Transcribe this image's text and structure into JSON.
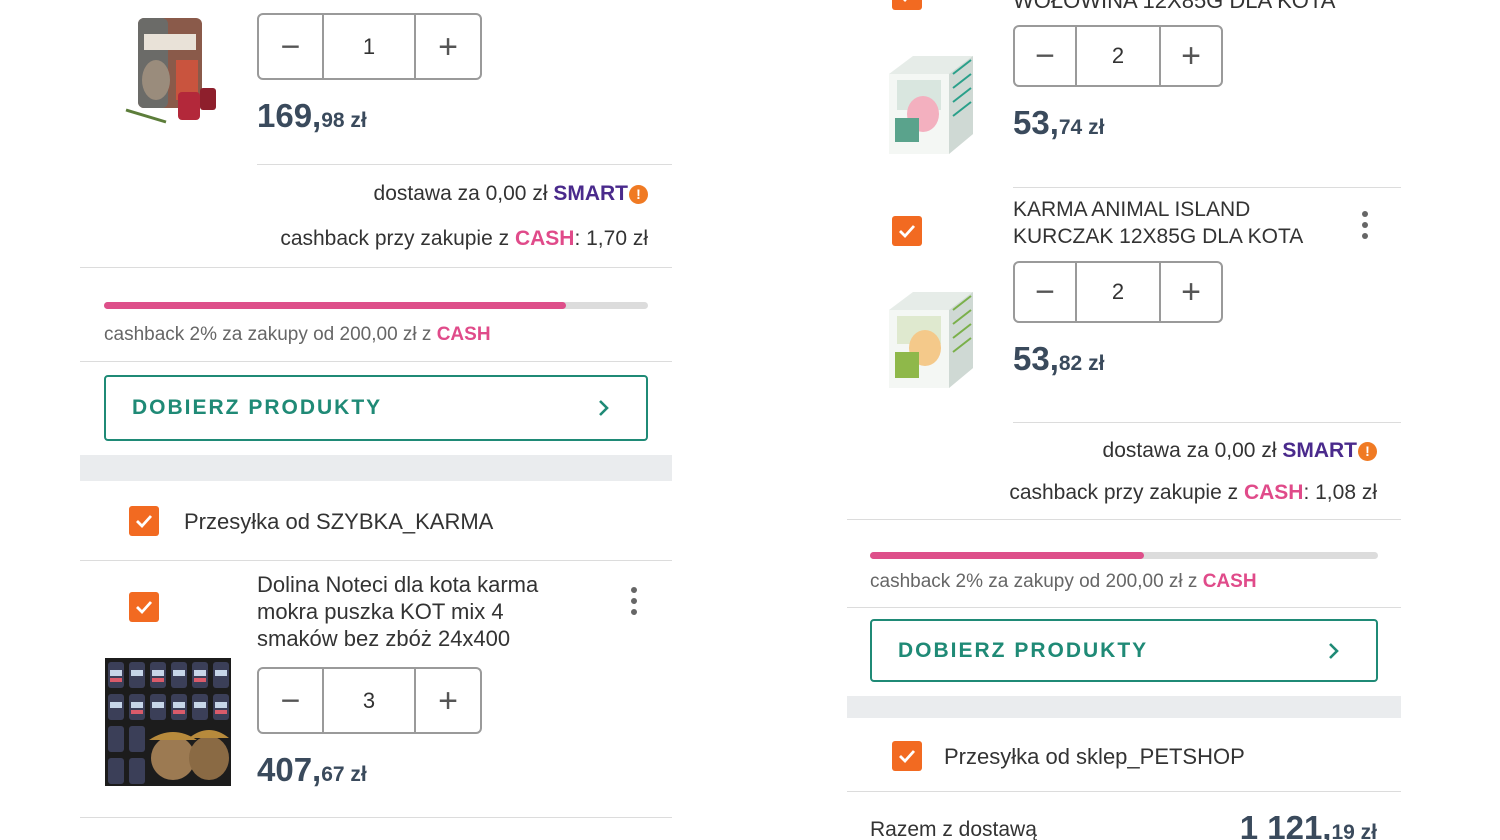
{
  "left": {
    "item1": {
      "qty": "1",
      "price_main": "169,",
      "price_frac": "98 zł"
    },
    "delivery": {
      "text": "dostawa za 0,00 zł ",
      "smart": "SMART",
      "badge": "!"
    },
    "cashback_line": {
      "pre": "cashback przy zakupie z ",
      "cash": "CASH",
      "post": ": 1,70 zł"
    },
    "progress": {
      "fraction": 0.85,
      "label_pre": "cashback 2% za zakupy od 200,00 zł z ",
      "label_cash": "CASH"
    },
    "dobierz": "DOBIERZ PRODUKTY",
    "seller": "Przesyłka od SZYBKA_KARMA",
    "item2": {
      "name_lines": [
        "Dolina Noteci dla kota karma",
        "mokra puszka KOT mix 4",
        "smaków bez zbóż 24x400"
      ],
      "qty": "3",
      "price_main": "407,",
      "price_frac": "67 zł"
    }
  },
  "right": {
    "item0": {
      "name_tail": "WOŁOWINA 12X85G DLA KOTA",
      "qty": "2",
      "price_main": "53,",
      "price_frac": "74 zł"
    },
    "item1": {
      "name_lines": [
        "KARMA ANIMAL ISLAND",
        "KURCZAK 12X85G DLA KOTA"
      ],
      "qty": "2",
      "price_main": "53,",
      "price_frac": "82 zł"
    },
    "delivery": {
      "text": "dostawa za 0,00 zł ",
      "smart": "SMART",
      "badge": "!"
    },
    "cashback_line": {
      "pre": "cashback przy zakupie z ",
      "cash": "CASH",
      "post": ": 1,08 zł"
    },
    "progress": {
      "fraction": 0.54,
      "label_pre": "cashback 2% za zakupy od 200,00 zł z ",
      "label_cash": "CASH"
    },
    "dobierz": "DOBIERZ PRODUKTY",
    "seller": "Przesyłka od sklep_PETSHOP",
    "total": {
      "label": "Razem z dostawą",
      "main": "1 121,",
      "frac": "19 zł"
    }
  },
  "colors": {
    "accent_orange": "#f26a21",
    "teal": "#1f8a76",
    "cash_pink": "#e04b8a",
    "smart_purple": "#4a2a8c"
  }
}
